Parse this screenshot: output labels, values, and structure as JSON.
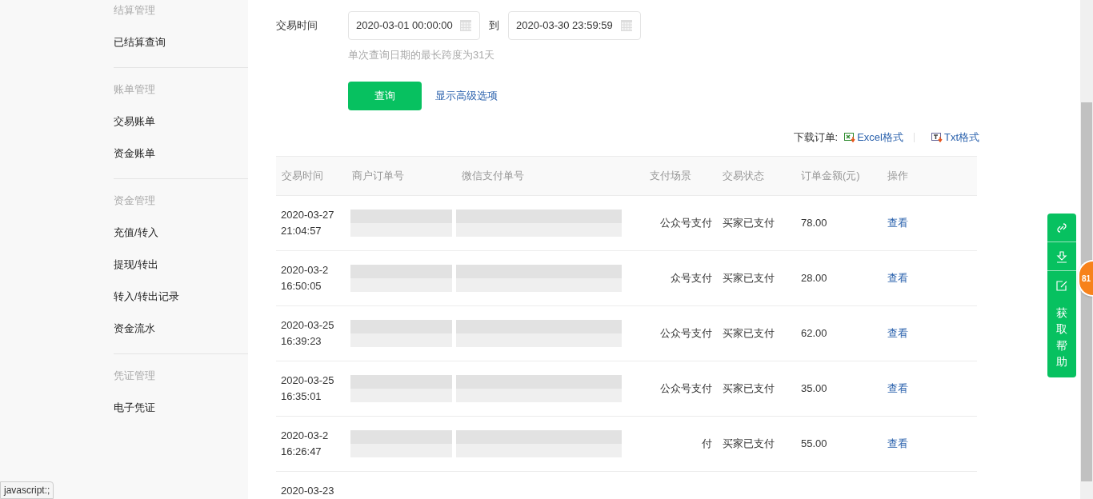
{
  "sidebar": {
    "groups": [
      {
        "title": "结算管理",
        "items": [
          "已结算查询"
        ]
      },
      {
        "title": "账单管理",
        "items": [
          "交易账单",
          "资金账单"
        ]
      },
      {
        "title": "资金管理",
        "items": [
          "充值/转入",
          "提现/转出",
          "转入/转出记录",
          "资金流水"
        ]
      },
      {
        "title": "凭证管理",
        "items": [
          "电子凭证"
        ]
      }
    ]
  },
  "filter": {
    "label": "交易时间",
    "start": "2020-03-01 00:00:00",
    "separator": "到",
    "end": "2020-03-30 23:59:59",
    "hint": "单次查询日期的最长跨度为31天",
    "search_button": "查询",
    "advanced_link": "显示高级选项"
  },
  "download": {
    "label": "下载订单:",
    "links": [
      {
        "kind": "excel",
        "label": "Excel格式"
      },
      {
        "kind": "txt",
        "label": "Txt格式"
      }
    ]
  },
  "table": {
    "columns": [
      "交易时间",
      "商户订单号",
      "微信支付单号",
      "支付场景",
      "交易状态",
      "订单金额(元)",
      "操作"
    ],
    "rows": [
      {
        "date": "2020-03-27",
        "time": "21:04:57",
        "scene": "公众号支付",
        "status": "买家已支付",
        "amount": "78.00",
        "action": "查看"
      },
      {
        "date": "2020-03-2",
        "time": "16:50:05",
        "scene": "众号支付",
        "status": "买家已支付",
        "amount": "28.00",
        "action": "查看"
      },
      {
        "date": "2020-03-25",
        "time": "16:39:23",
        "scene": "公众号支付",
        "status": "买家已支付",
        "amount": "62.00",
        "action": "查看"
      },
      {
        "date": "2020-03-25",
        "time": "16:35:01",
        "scene": "公众号支付",
        "status": "买家已支付",
        "amount": "35.00",
        "action": "查看"
      },
      {
        "date": "2020-03-2",
        "time": "16:26:47",
        "scene": "付",
        "status": "买家已支付",
        "amount": "55.00",
        "action": "查看"
      },
      {
        "date": "2020-03-23"
      }
    ]
  },
  "help_panel": {
    "label": "获取帮助",
    "badge": "81"
  },
  "status_tooltip": "javascript:;"
}
